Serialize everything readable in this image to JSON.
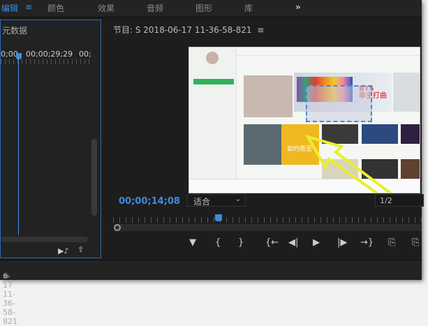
{
  "workspace_tabs": [
    "编辑",
    "颜色",
    "效果",
    "音频",
    "图形",
    "库"
  ],
  "overflow_icon": "»",
  "menu_icon": "≡",
  "left_panel": {
    "title": "元数据",
    "tc_start": "0;00",
    "tc_mid": "00;00;29;29",
    "tc_end": "00;"
  },
  "program": {
    "title": "节目: S 2018-06-17 11-36-58-821",
    "timecode": "00;00;14;08",
    "fit": "适合",
    "resolution": "1/2",
    "video": {
      "banner_text_1": "BTS",
      "banner_text_2": "非主打曲",
      "card_text": "如约而至"
    },
    "accent": "#3b8de0",
    "annotation_color": "#e8f02a"
  },
  "controls": [
    "▼",
    "{",
    "}",
    "{←",
    "◀|",
    "▶",
    "|▶",
    "→}",
    "⎘",
    "⎘"
  ],
  "sequence_tab": "6-17 11-36-58-821"
}
